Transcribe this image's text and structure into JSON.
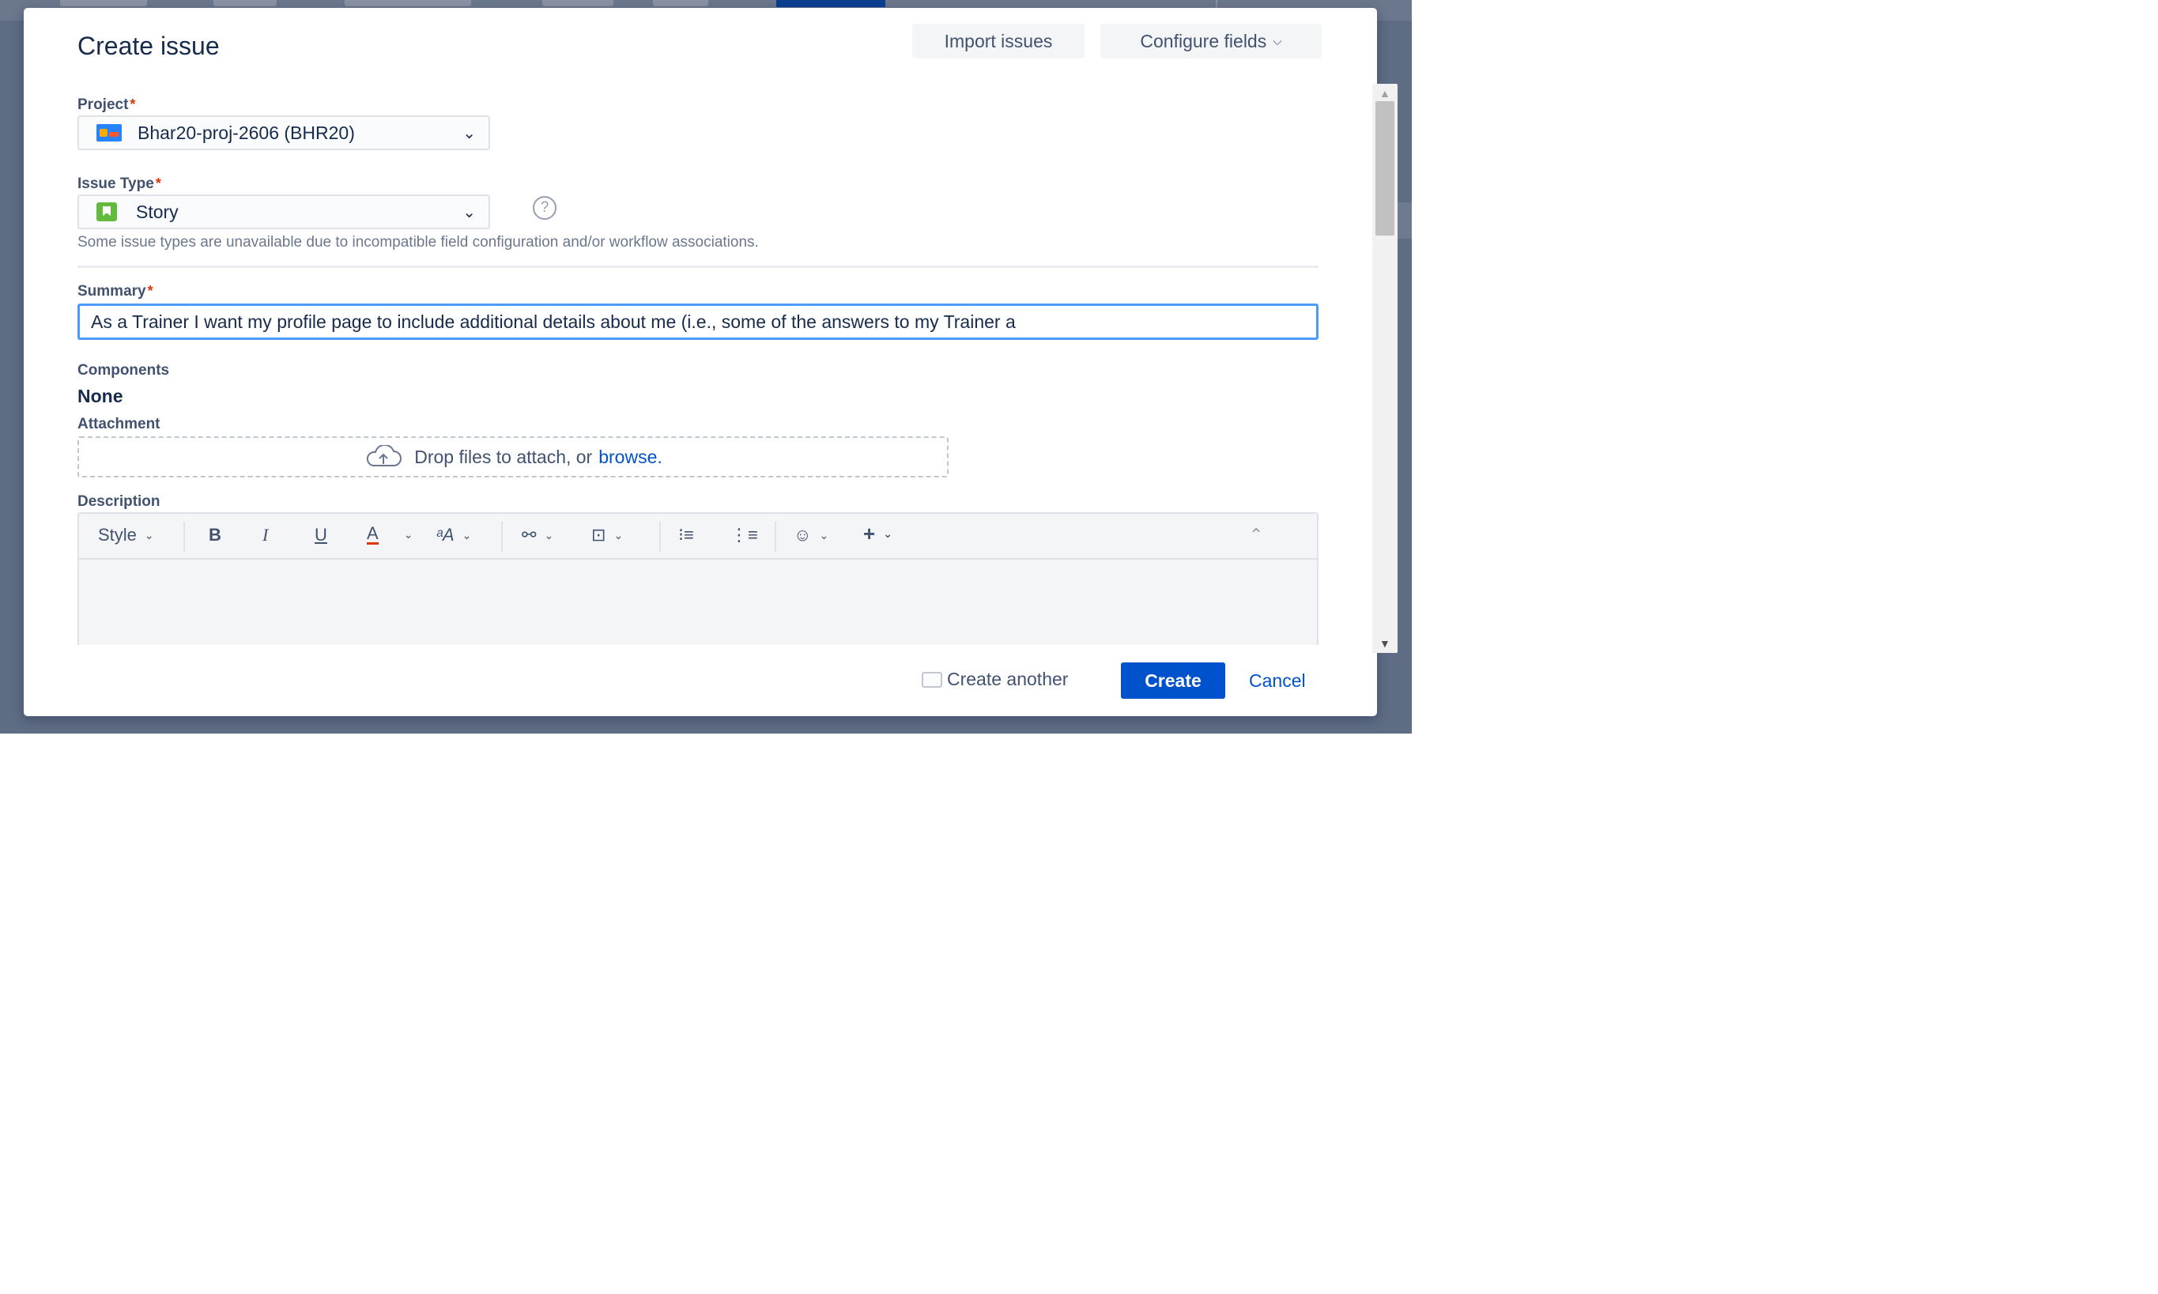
{
  "dialog": {
    "title": "Create issue",
    "import_label": "Import issues",
    "configure_label": "Configure fields"
  },
  "project": {
    "label": "Project",
    "required_mark": "*",
    "value": "Bhar20-proj-2606 (BHR20)"
  },
  "issue_type": {
    "label": "Issue Type",
    "required_mark": "*",
    "value": "Story",
    "help_glyph": "?",
    "hint": "Some issue types are unavailable due to incompatible field configuration and/or workflow associations."
  },
  "summary": {
    "label": "Summary",
    "required_mark": "*",
    "value": "As a Trainer I want my profile page to include additional details about me (i.e., some of the answers to my Trainer a"
  },
  "components": {
    "label": "Components",
    "value": "None"
  },
  "attachment": {
    "label": "Attachment",
    "drop_text": "Drop files to attach, or",
    "browse_text": "browse."
  },
  "description": {
    "label": "Description",
    "toolbar": {
      "style": "Style",
      "bold": "B",
      "italic": "I",
      "underline": "U",
      "text_color": "A",
      "text_size": "ᵃA",
      "link": "⚯",
      "attachment": "⊡",
      "bullet_list": "⁝≡",
      "numbered_list": "⋮≡",
      "emoji": "☺",
      "insert": "+",
      "collapse": "⌃"
    }
  },
  "footer": {
    "create_another_label": "Create another",
    "create_label": "Create",
    "cancel_label": "Cancel"
  },
  "colors": {
    "primary": "#0052cc",
    "required": "#de350b",
    "focus": "#4c9aff",
    "story": "#63ba3c"
  }
}
